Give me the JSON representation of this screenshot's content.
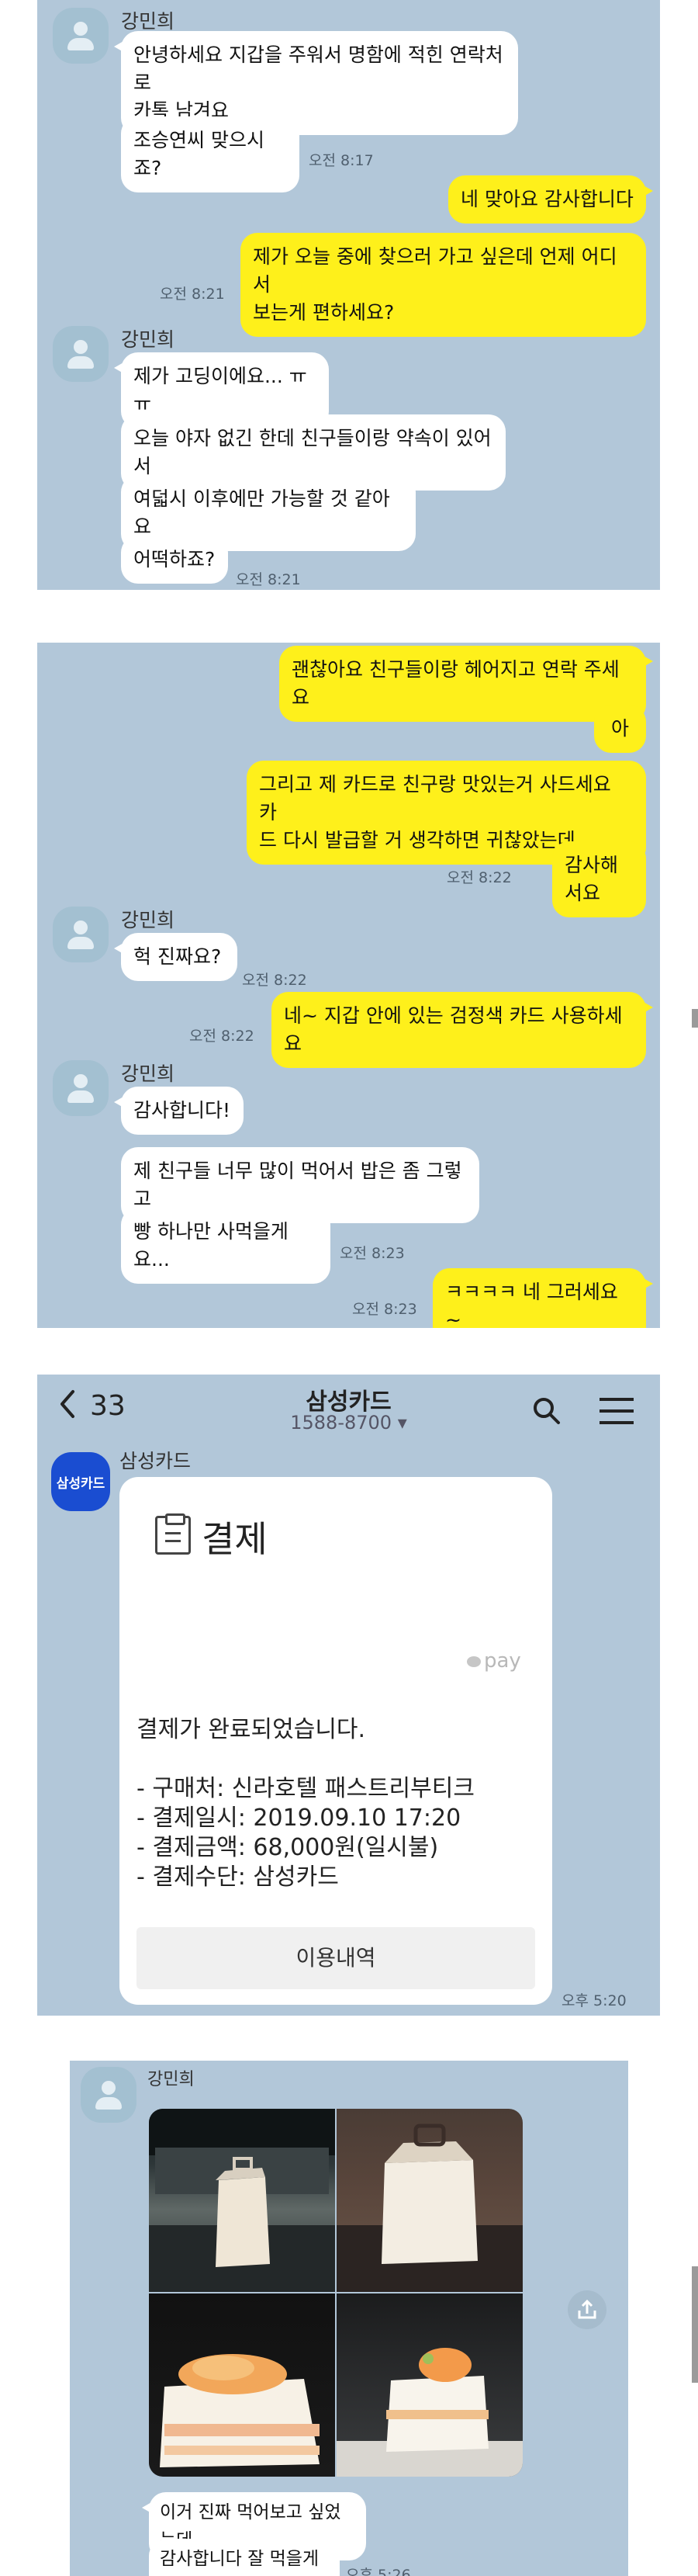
{
  "panel1": {
    "sender1": "강민희",
    "m1": "안녕하세요 지갑을 주워서 명함에 적힌 연락처로\n카톡 남겨요",
    "m2": "조승연씨 맞으시죠?",
    "t1": "오전 8:17",
    "r1": "네 맞아요 감사합니다",
    "r2": "제가 오늘 중에 찾으러 가고 싶은데 언제 어디서\n보는게 편하세요?",
    "t2": "오전 8:21",
    "sender2": "강민희",
    "m3": "제가 고딩이에요... ㅠㅠ",
    "m4": "오늘 야자 없긴 한데 친구들이랑 약속이 있어서",
    "m5": "여덟시 이후에만 가능할 것 같아요",
    "m6": "어떡하죠?",
    "t3": "오전 8:21"
  },
  "panel2": {
    "r1": "괜찮아요 친구들이랑 헤어지고 연락 주세요",
    "r2": "아",
    "r3": "그리고 제 카드로 친구랑 맛있는거 사드세요 카\n드 다시 발급할 거 생각하면 귀찮았는데",
    "r4": "감사해서요",
    "t1": "오전 8:22",
    "sender1": "강민희",
    "m1": "헉 진짜요?",
    "t2": "오전 8:22",
    "r5": "네~ 지갑 안에 있는 검정색 카드 사용하세요",
    "t3": "오전 8:22",
    "sender2": "강민희",
    "m2": "감사합니다!",
    "m3": "제 친구들 너무 많이 먹어서 밥은 좀 그렇고",
    "m4": "빵 하나만 사먹을게요...",
    "t4": "오전 8:23",
    "r6": "ㅋㅋㅋㅋ 네 그러세요~",
    "t5": "오전 8:23"
  },
  "panel3": {
    "back_count": "33",
    "title": "삼성카드",
    "subtitle": "1588-8700 ▾",
    "logo_text": "삼성카드",
    "sender": "삼성카드",
    "card_title": "결제",
    "pay_label": "pay",
    "line1": "결제가 완료되었습니다.",
    "line2": "- 구매처: 신라호텔 패스트리부티크",
    "line3": "- 결제일시: 2019.09.10 17:20",
    "line4": "- 결제금액: 68,000원(일시불)",
    "line5": "- 결제수단: 삼성카드",
    "button": "이용내역",
    "time": "오후 5:20"
  },
  "panel4": {
    "sender": "강민희",
    "m1": "이거 진짜 먹어보고 싶었는데",
    "m2": "감사합니다 잘 먹을게요!",
    "time": "오후 5:26"
  },
  "icons": [
    "chevron-left-icon",
    "search-icon",
    "menu-icon",
    "share-icon",
    "clipboard-icon",
    "avatar-icon"
  ],
  "colors": {
    "chat_bg": "#b2c7d9",
    "outgoing": "#fef01b",
    "incoming": "#ffffff",
    "samsung_blue": "#1a4dd1"
  }
}
